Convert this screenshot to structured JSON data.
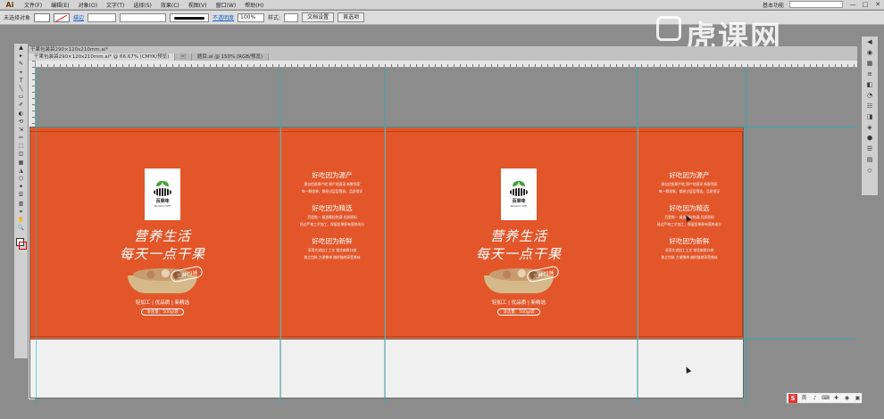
{
  "app": {
    "logo": "Ai"
  },
  "menu": {
    "items": [
      "文件(F)",
      "编辑(E)",
      "对象(O)",
      "文字(T)",
      "选择(S)",
      "效果(C)",
      "视图(V)",
      "窗口(W)",
      "帮助(H)"
    ],
    "workspace": "基本功能",
    "window_buttons": [
      "—",
      "□",
      "✕"
    ]
  },
  "controlbar": {
    "selection": "未选择对象",
    "stroke_label": "描边",
    "opacity_label": "不透明度",
    "opacity_value": "100%",
    "style_label": "样式:",
    "doc_setup": "文档设置",
    "preferences": "首选项"
  },
  "document": {
    "title": "干果包装袋290×120x210mm.ai*",
    "tabs": [
      "干果包装袋290×120x210mm.ai* @ 66.67% (CMYK/预览)",
      "\u001f",
      "题目.ai @ 150% (RGB/预览)"
    ]
  },
  "watermark": {
    "text": "虎课网"
  },
  "tools": [
    "▲",
    "▸",
    "✎",
    "⌖",
    "T",
    "╲",
    "▭",
    "✐",
    "◐",
    "⟲",
    "⇲",
    "✂",
    "⬚",
    "◫",
    "▦",
    "◮",
    "⬡",
    "✦",
    "☰",
    "▥",
    "⌗",
    "✋",
    "🔍"
  ],
  "right_panel_icons": [
    "◀",
    "◉",
    "▦",
    "≡",
    "◧",
    "◔",
    "☷",
    "◨",
    "◈",
    "⬢",
    "☰",
    "▤",
    "◇"
  ],
  "artwork": {
    "front_panels": [
      {
        "logo_text": "百果味",
        "logo_sub": "BAIGUO WEI",
        "slogan_line1": "营养生活",
        "slogan_line2": "每天一点干果",
        "badge": "三种口味",
        "tagline": "轻加工 | 优品质 | 新精选",
        "weight": "净含量：500g/袋"
      },
      {
        "logo_text": "百果味",
        "logo_sub": "BAIGUO WEI",
        "slogan_line1": "营养生活",
        "slogan_line2": "每天一点干果",
        "badge": "三种口味",
        "tagline": "轻加工 | 优品质 | 新精选",
        "weight": "净含量：500g/袋"
      }
    ],
    "back_panels": [
      {
        "h1": "好吃因为源产",
        "p1": "源自优质原产地 原产地直采 新鲜到家",
        "p1b": "每一颗坚果，都经过层层筛选，品质保证",
        "h2": "好吃因为精选",
        "p2": "百里挑一 精选颗粒饱满 优质原料",
        "p2b": "经过严格工艺加工，保留坚果原有营养成分",
        "h3": "好吃因为新鲜",
        "p3": "采用先进加工工艺 锁住新鲜口感",
        "p3b": "独立包装 方便携带 随时随地享受美味"
      },
      {
        "h1": "好吃因为源产",
        "p1": "源自优质原产地 原产地直采 新鲜到家",
        "p1b": "每一颗坚果，都经过层层筛选，品质保证",
        "h2": "好吃因为精选",
        "p2": "百里挑一 精选颗粒饱满 优质原料",
        "p2b": "经过严格工艺加工，保留坚果原有营养成分",
        "h3": "好吃因为新鲜",
        "p3": "采用先进加工工艺 锁住新鲜口感",
        "p3b": "独立包装 方便携带 随时随地享受美味"
      }
    ]
  },
  "tray": {
    "logo": "S",
    "icons": [
      "英",
      "♪",
      "⌨",
      "✚",
      "◉",
      "▣"
    ]
  },
  "colors": {
    "package_orange": "#e2562a",
    "background_gray": "#8c8c8c",
    "guide_cyan": "#00bec8"
  }
}
